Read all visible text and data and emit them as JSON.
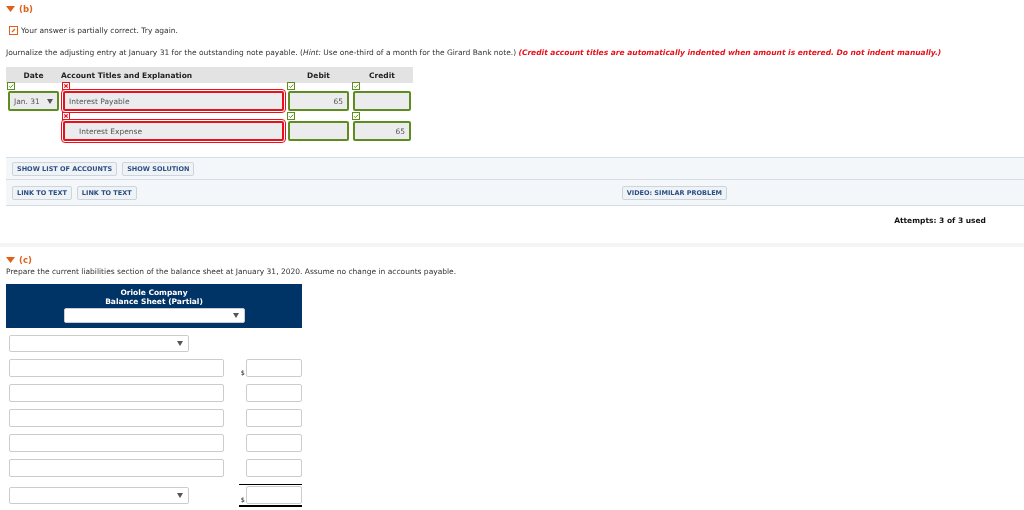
{
  "part_b": {
    "label": "(b)",
    "expanded": true,
    "feedback": {
      "text": "Your answer is partially correct.  Try again."
    },
    "instruction": "Journalize the adjusting entry at January 31 for the outstanding note payable. (*Hint:* Use one-third of a month for the Girard Bank note.)",
    "warning": "(Credit account titles are automatically indented when amount is entered. Do not indent manually.)",
    "journal": {
      "columns": [
        "Date",
        "Account Titles and Explanation",
        "Debit",
        "Credit"
      ],
      "rows": [
        {
          "date": {
            "value": "Jan. 31",
            "correct": true
          },
          "account": {
            "value": "Interest Payable",
            "correct": false,
            "indented": false
          },
          "debit": {
            "value": "65",
            "correct": true
          },
          "credit": {
            "correct": true
          }
        },
        {
          "account": {
            "value": "Interest Expense",
            "correct": false,
            "indented": true
          },
          "debit": {
            "correct": true
          },
          "credit": {
            "value": "65",
            "correct": true
          }
        }
      ]
    },
    "tool_buttons": [
      "SHOW LIST OF ACCOUNTS",
      "SHOW SOLUTION"
    ],
    "links": [
      "LINK TO TEXT",
      "LINK TO TEXT"
    ],
    "video_button": "VIDEO: SIMILAR PROBLEM",
    "attempts": "Attempts: 3 of 3 used"
  },
  "part_c": {
    "label": "(c)",
    "expanded": true,
    "instruction": "Prepare the current liabilities section of the balance sheet at January 31, 2020. Assume no change in accounts payable.",
    "sheet": {
      "company": "Oriole Company",
      "title": "Balance Sheet (Partial)",
      "lines": [
        {
          "kind": "heading"
        },
        {
          "kind": "item",
          "dollar": "$"
        },
        {
          "kind": "item"
        },
        {
          "kind": "item"
        },
        {
          "kind": "item"
        },
        {
          "kind": "item"
        },
        {
          "kind": "total",
          "dollar": "$"
        }
      ]
    }
  }
}
